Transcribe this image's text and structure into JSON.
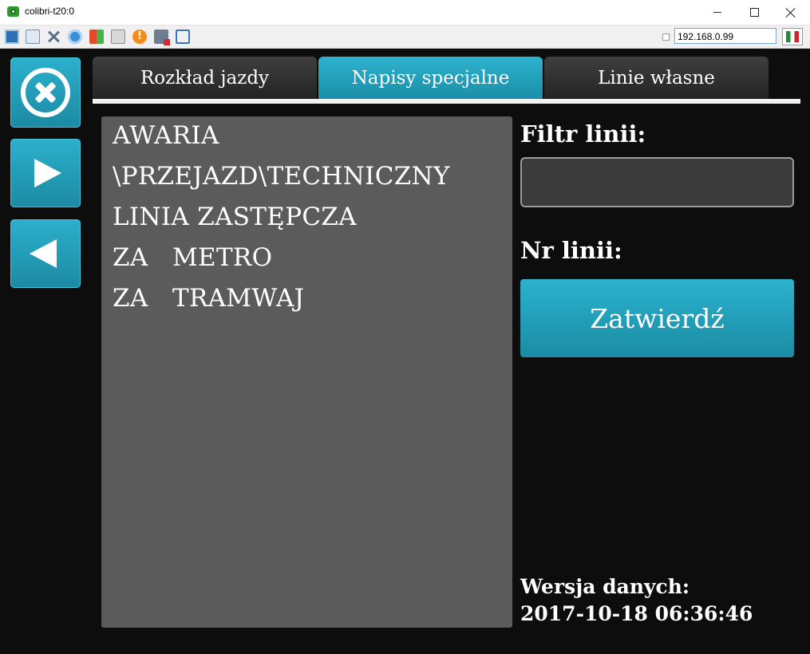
{
  "window": {
    "title": "colibri-t20:0"
  },
  "toolbar": {
    "icons": [
      "monitor-icon",
      "windows-icon",
      "tools-icon",
      "refresh-icon",
      "windows-logo-icon",
      "keyboard-icon",
      "alert-icon",
      "network-disconnect-icon",
      "fullscreen-icon"
    ],
    "ip_address": "192.168.0.99",
    "flag_icon": "flag-icon"
  },
  "sidebar": {
    "buttons": [
      "close-icon",
      "play-right-icon",
      "play-left-icon"
    ]
  },
  "tabs": [
    {
      "label": "Rozkład jazdy",
      "active": false
    },
    {
      "label": "Napisy specjalne",
      "active": true
    },
    {
      "label": "Linie własne",
      "active": false
    }
  ],
  "list": {
    "items": [
      "AWARIA",
      "\\PRZEJAZD\\TECHNICZNY",
      "LINIA ZASTĘPCZA",
      "ZA   METRO",
      "ZA   TRAMWAJ"
    ]
  },
  "right_panel": {
    "filter_label": "Filtr linii:",
    "filter_value": "",
    "line_number_label": "Nr linii:",
    "confirm_label": "Zatwierdź",
    "version_label": "Wersja danych:",
    "version_date": "2017-10-18 06:36:46"
  },
  "colors": {
    "accent": "#1f9ab6",
    "background": "#0d0d0d",
    "panel": "#5b5b5b"
  }
}
